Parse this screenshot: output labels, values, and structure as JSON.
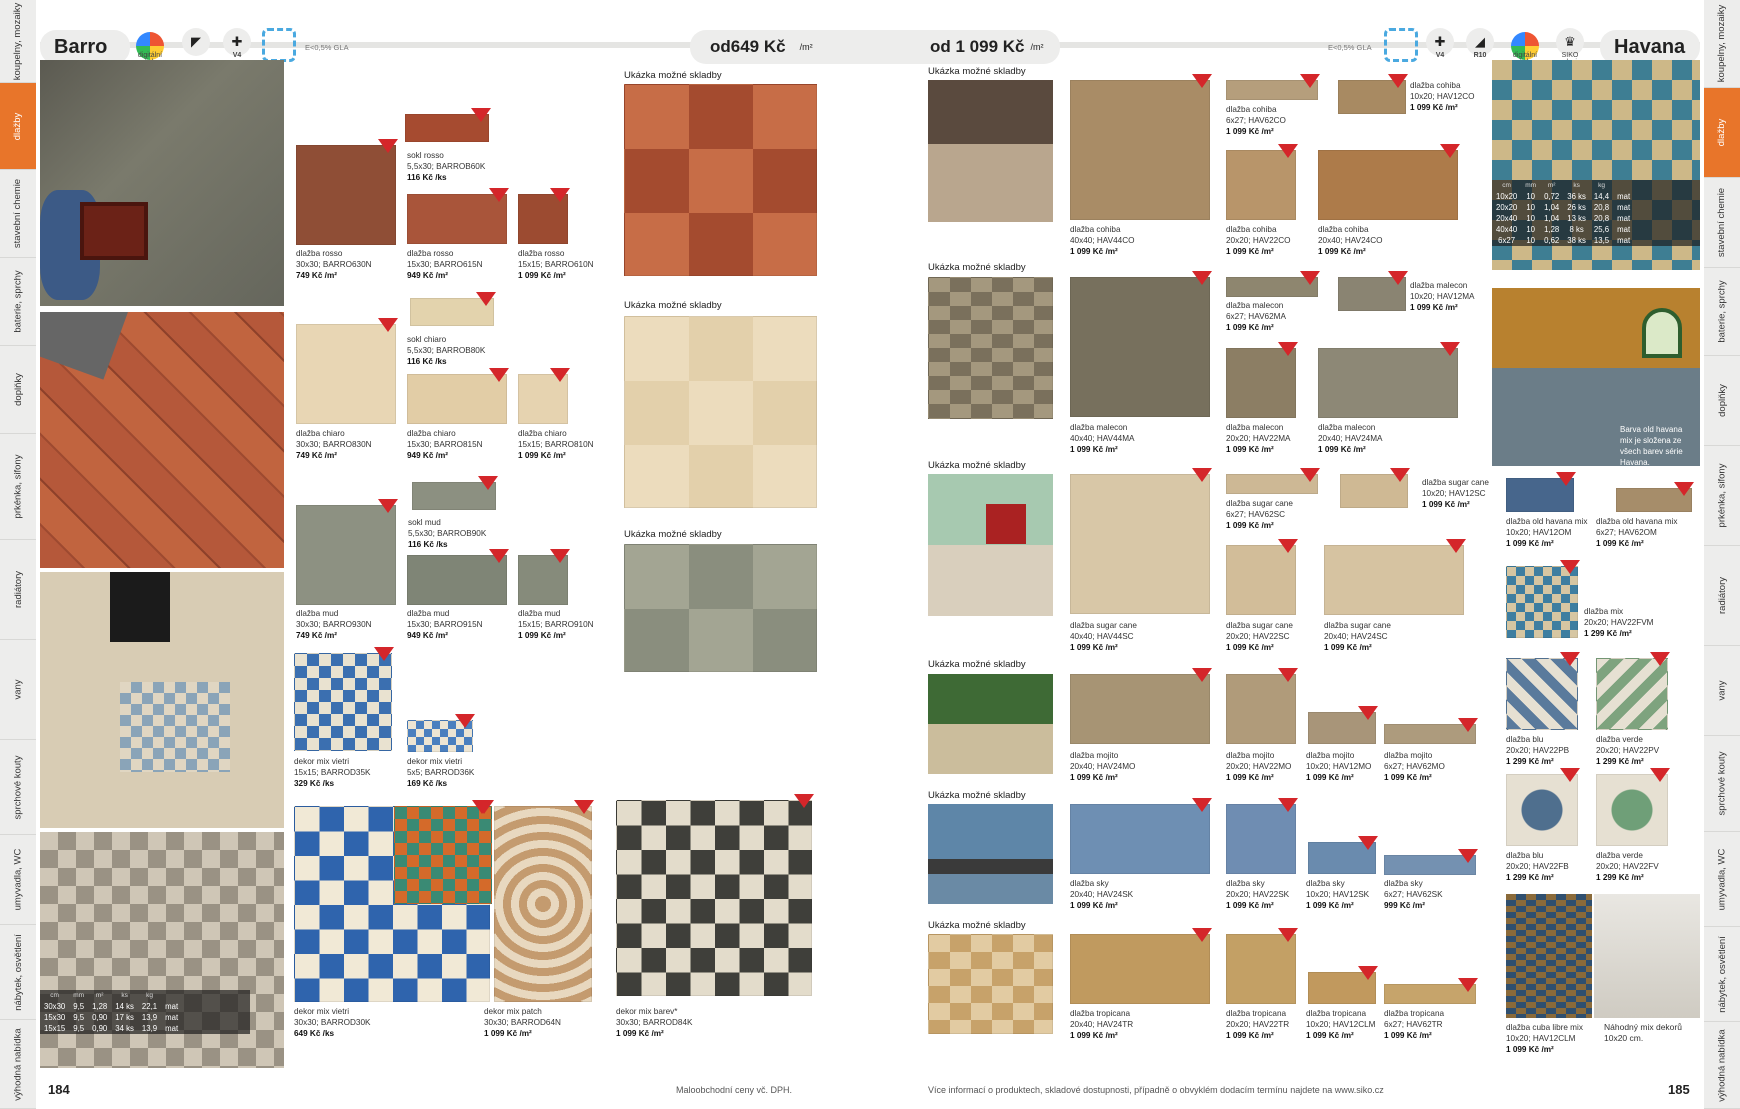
{
  "left_tabs": [
    "koupelny, mozaiky",
    "dlažby",
    "stavební chemie",
    "baterie, sprchy",
    "doplňky",
    "prkénka, sifony",
    "radiátory",
    "vany",
    "sprchové kouty",
    "umyvadla, WC",
    "nábytek, osvětlení",
    "výhodná nabídka"
  ],
  "right_tabs": [
    "koupelny, mozaiky",
    "dlažby",
    "stavební chemie",
    "baterie, sprchy",
    "doplňky",
    "prkénka, sifony",
    "radiátory",
    "vany",
    "sprchové kouty",
    "umyvadla, WC",
    "nábytek, osvětlení",
    "výhodná nabídka"
  ],
  "colors": {
    "accent": "#e8752a",
    "badge": "#d4262a",
    "glaze": "#4aa9e0"
  },
  "left": {
    "title": "Barro",
    "icons": [
      {
        "name": "digital-print-icon",
        "label": "digitální tisk"
      },
      {
        "name": "rectified-edge-icon",
        "label": ""
      },
      {
        "name": "shade-variation-icon",
        "label": "V4"
      }
    ],
    "absorption": "E<0,5% GLA",
    "price_from": "od649 Kč",
    "price_unit": "/m²",
    "page_number": "184",
    "footer": "Maloobchodní ceny vč. DPH.",
    "spec": {
      "head": [
        "cm",
        "mm",
        "m²",
        "ks",
        "kg",
        ""
      ],
      "rows": [
        [
          "30x30",
          "9,5",
          "1,28",
          "14 ks",
          "22,1",
          "mat"
        ],
        [
          "15x30",
          "9,5",
          "0,90",
          "17 ks",
          "13,9",
          "mat"
        ],
        [
          "15x15",
          "9,5",
          "0,90",
          "34 ks",
          "13,9",
          "mat"
        ]
      ]
    },
    "products": [
      {
        "l1": "sokl rosso",
        "l2": "5,5x30; BARROB60K",
        "l3": "116 Kč /ks",
        "badge": ""
      },
      {
        "l1": "dlažba rosso",
        "l2": "30x30; BARRO630N",
        "l3": "749 Kč /m²",
        "badge": "5"
      },
      {
        "l1": "dlažba rosso",
        "l2": "15x30; BARRO615N",
        "l3": "949 Kč /m²",
        "badge": "5"
      },
      {
        "l1": "dlažba rosso",
        "l2": "15x15; BARRO610N",
        "l3": "1 099 Kč /m²",
        "badge": "5"
      },
      {
        "l1": "sokl chiaro",
        "l2": "5,5x30; BARROB80K",
        "l3": "116 Kč /ks",
        "badge": ""
      },
      {
        "l1": "dlažba chiaro",
        "l2": "30x30; BARRO830N",
        "l3": "749 Kč /m²",
        "badge": "5"
      },
      {
        "l1": "dlažba chiaro",
        "l2": "15x30; BARRO815N",
        "l3": "949 Kč /m²",
        "badge": "5"
      },
      {
        "l1": "dlažba chiaro",
        "l2": "15x15; BARRO810N",
        "l3": "1 099 Kč /m²",
        "badge": "5"
      },
      {
        "l1": "sokl mud",
        "l2": "5,5x30; BARROB90K",
        "l3": "116 Kč /ks",
        "badge": ""
      },
      {
        "l1": "dlažba mud",
        "l2": "30x30; BARRO930N",
        "l3": "749 Kč /m²",
        "badge": "5"
      },
      {
        "l1": "dlažba mud",
        "l2": "15x30; BARRO915N",
        "l3": "949 Kč /m²",
        "badge": "5"
      },
      {
        "l1": "dlažba mud",
        "l2": "15x15; BARRO910N",
        "l3": "1 099 Kč /m²",
        "badge": "5"
      },
      {
        "l1": "dekor mix vietri",
        "l2": "15x15; BARROD35K",
        "l3": "329 Kč /ks",
        "badge": "5"
      },
      {
        "l1": "dekor mix vietri",
        "l2": "5x5; BARROD36K",
        "l3": "169 Kč /ks",
        "badge": ""
      },
      {
        "l1": "dekor mix vietri",
        "l2": "30x30; BARROD30K",
        "l3": "649 Kč /ks",
        "badge": "5"
      },
      {
        "l1": "dekor mix patch",
        "l2": "30x30; BARROD64N",
        "l3": "1 099 Kč /m²",
        "badge": "5"
      },
      {
        "l1": "dekor mix barev*",
        "l2": "30x30; BARROD84K",
        "l3": "1 099 Kč /m²",
        "badge": "5"
      }
    ],
    "layouts": [
      "Ukázka možné skladby",
      "Ukázka možné skladby",
      "Ukázka možné skladby"
    ]
  },
  "right": {
    "title": "Havana",
    "icons": [
      {
        "name": "shade-variation-icon",
        "label": "V4"
      },
      {
        "name": "slip-resistance-icon",
        "label": "R10"
      },
      {
        "name": "digital-print-icon",
        "label": "digitální tisk"
      },
      {
        "name": "siko-exclusive-icon",
        "label": "SIKO exclusive"
      }
    ],
    "absorption": "E<0,5% GLA",
    "price_from": "od 1 099 Kč",
    "price_unit": "/m²",
    "page_number": "185",
    "footer": "Více informací o produktech, skladové dostupnosti, případně o obvyklém dodacím termínu najdete na www.siko.cz",
    "photo_caption": "Barva old havana mix je složena ze všech barev série Havana.",
    "mix_caption": "Náhodný mix dekorů 10x20 cm.",
    "spec": {
      "head": [
        "cm",
        "mm",
        "m²",
        "ks",
        "kg",
        ""
      ],
      "rows": [
        [
          "10x20",
          "10",
          "0,72",
          "36 ks",
          "14,4",
          "mat"
        ],
        [
          "20x20",
          "10",
          "1,04",
          "26 ks",
          "20,8",
          "mat"
        ],
        [
          "20x40",
          "10",
          "1,04",
          "13 ks",
          "20,8",
          "mat"
        ],
        [
          "40x40",
          "10",
          "1,28",
          "8 ks",
          "25,6",
          "mat"
        ],
        [
          "6x27",
          "10",
          "0,62",
          "38 ks",
          "13,5",
          "mat"
        ]
      ]
    },
    "layouts": [
      "Ukázka možné skladby",
      "Ukázka možné skladby",
      "Ukázka možné skladby",
      "Ukázka možné skladby",
      "Ukázka možné skladby",
      "Ukázka možné skladby"
    ],
    "products": [
      {
        "l1": "dlažba cohiba",
        "l2": "6x27; HAV62CO",
        "l3": "1 099 Kč /m²"
      },
      {
        "l1": "dlažba cohiba",
        "l2": "10x20; HAV12CO",
        "l3": "1 099 Kč /m²"
      },
      {
        "l1": "dlažba cohiba",
        "l2": "40x40; HAV44CO",
        "l3": "1 099 Kč /m²"
      },
      {
        "l1": "dlažba cohiba",
        "l2": "20x20; HAV22CO",
        "l3": "1 099 Kč /m²"
      },
      {
        "l1": "dlažba cohiba",
        "l2": "20x40; HAV24CO",
        "l3": "1 099 Kč /m²"
      },
      {
        "l1": "dlažba malecon",
        "l2": "6x27; HAV62MA",
        "l3": "1 099 Kč /m²"
      },
      {
        "l1": "dlažba malecon",
        "l2": "10x20; HAV12MA",
        "l3": "1 099 Kč /m²"
      },
      {
        "l1": "dlažba malecon",
        "l2": "40x40; HAV44MA",
        "l3": "1 099 Kč /m²"
      },
      {
        "l1": "dlažba malecon",
        "l2": "20x20; HAV22MA",
        "l3": "1 099 Kč /m²"
      },
      {
        "l1": "dlažba malecon",
        "l2": "20x40; HAV24MA",
        "l3": "1 099 Kč /m²"
      },
      {
        "l1": "dlažba sugar cane",
        "l2": "6x27; HAV62SC",
        "l3": "1 099 Kč /m²"
      },
      {
        "l1": "dlažba sugar cane",
        "l2": "10x20; HAV12SC",
        "l3": "1 099 Kč /m²"
      },
      {
        "l1": "dlažba sugar cane",
        "l2": "40x40; HAV44SC",
        "l3": "1 099 Kč /m²"
      },
      {
        "l1": "dlažba sugar cane",
        "l2": "20x20; HAV22SC",
        "l3": "1 099 Kč /m²"
      },
      {
        "l1": "dlažba sugar cane",
        "l2": "20x40; HAV24SC",
        "l3": "1 099 Kč /m²"
      },
      {
        "l1": "dlažba mojito",
        "l2": "20x40; HAV24MO",
        "l3": "1 099 Kč /m²"
      },
      {
        "l1": "dlažba mojito",
        "l2": "20x20; HAV22MO",
        "l3": "1 099 Kč /m²"
      },
      {
        "l1": "dlažba mojito",
        "l2": "10x20; HAV12MO",
        "l3": "1 099 Kč /m²"
      },
      {
        "l1": "dlažba mojito",
        "l2": "6x27; HAV62MO",
        "l3": "1 099 Kč /m²"
      },
      {
        "l1": "dlažba sky",
        "l2": "20x40; HAV24SK",
        "l3": "1 099 Kč /m²"
      },
      {
        "l1": "dlažba sky",
        "l2": "20x20; HAV22SK",
        "l3": "1 099 Kč /m²"
      },
      {
        "l1": "dlažba sky",
        "l2": "10x20; HAV12SK",
        "l3": "1 099 Kč /m²"
      },
      {
        "l1": "dlažba sky",
        "l2": "6x27; HAV62SK",
        "l3": "999 Kč /m²"
      },
      {
        "l1": "dlažba tropicana",
        "l2": "20x40; HAV24TR",
        "l3": "1 099 Kč /m²"
      },
      {
        "l1": "dlažba tropicana",
        "l2": "20x20; HAV22TR",
        "l3": "1 099 Kč /m²"
      },
      {
        "l1": "dlažba tropicana",
        "l2": "10x20; HAV12CLM",
        "l3": "1 099 Kč /m²"
      },
      {
        "l1": "dlažba tropicana",
        "l2": "6x27; HAV62TR",
        "l3": "1 099 Kč /m²"
      },
      {
        "l1": "dlažba old havana mix",
        "l2": "10x20; HAV12OM",
        "l3": "1 099 Kč /m²"
      },
      {
        "l1": "dlažba old havana mix",
        "l2": "6x27; HAV62OM",
        "l3": "1 099 Kč /m²"
      },
      {
        "l1": "dlažba mix",
        "l2": "20x20; HAV22FVM",
        "l3": "1 299 Kč /m²"
      },
      {
        "l1": "dlažba blu",
        "l2": "20x20; HAV22PB",
        "l3": "1 299 Kč /m²"
      },
      {
        "l1": "dlažba verde",
        "l2": "20x20; HAV22PV",
        "l3": "1 299 Kč /m²"
      },
      {
        "l1": "dlažba blu",
        "l2": "20x20; HAV22FB",
        "l3": "1 299 Kč /m²"
      },
      {
        "l1": "dlažba verde",
        "l2": "20x20; HAV22FV",
        "l3": "1 299 Kč /m²"
      },
      {
        "l1": "dlažba cuba libre mix",
        "l2": "10x20; HAV12CLM",
        "l3": "1 099 Kč /m²"
      }
    ]
  }
}
